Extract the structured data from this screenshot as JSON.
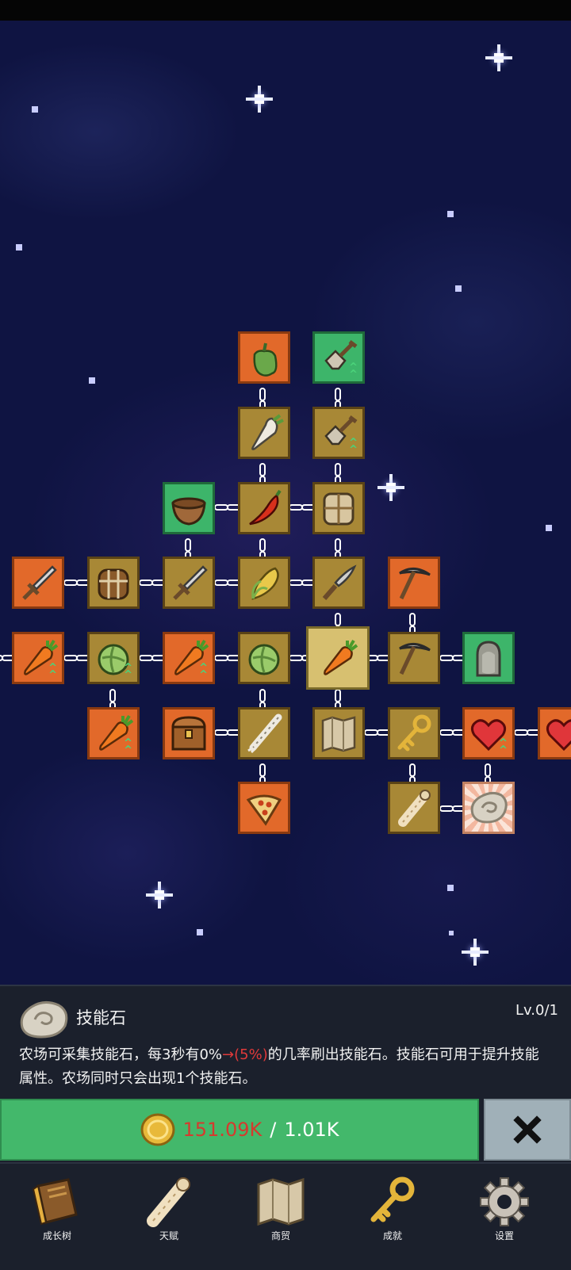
{
  "skill": {
    "title": "技能石",
    "level": "Lv.0/1",
    "desc_before": "农场可采集技能石，每3秒有0%",
    "desc_arrow": "→",
    "desc_highlight": "(5%)",
    "desc_after": "的几率刷出技能石。技能石可用于提升技能属性。农场同时只会出现1个技能石。"
  },
  "cost": {
    "have": "151.09K",
    "separator": "/",
    "need": "1.01K"
  },
  "nav": [
    {
      "label": "成长树",
      "icon": "book-icon"
    },
    {
      "label": "天赋",
      "icon": "scroll-icon"
    },
    {
      "label": "商贸",
      "icon": "map-icon"
    },
    {
      "label": "成就",
      "icon": "key-icon"
    },
    {
      "label": "设置",
      "icon": "gear-icon"
    }
  ],
  "nodes": [
    {
      "id": "pepper",
      "icon": "pepper-icon",
      "color": "orange"
    },
    {
      "id": "shovel-green",
      "icon": "shovel-icon",
      "color": "green",
      "upgrade": true
    },
    {
      "id": "radish",
      "icon": "radish-icon",
      "color": "tan"
    },
    {
      "id": "shovel",
      "icon": "shovel-icon",
      "color": "tan",
      "upgrade": true
    },
    {
      "id": "bowl",
      "icon": "bowl-icon",
      "color": "green"
    },
    {
      "id": "chili",
      "icon": "chili-icon",
      "color": "tan"
    },
    {
      "id": "sack",
      "icon": "sack-icon",
      "color": "tan"
    },
    {
      "id": "sword-orange",
      "icon": "sword-icon",
      "color": "orange"
    },
    {
      "id": "backpack",
      "icon": "backpack-icon",
      "color": "tan"
    },
    {
      "id": "sword",
      "icon": "sword-icon",
      "color": "tan"
    },
    {
      "id": "corn",
      "icon": "corn-icon",
      "color": "tan"
    },
    {
      "id": "knife",
      "icon": "knife-icon",
      "color": "tan"
    },
    {
      "id": "pickaxe-orange",
      "icon": "pickaxe-icon",
      "color": "orange"
    },
    {
      "id": "carrot-boost-1",
      "icon": "carrot-icon",
      "color": "orange",
      "upgrade": true
    },
    {
      "id": "cabbage-1",
      "icon": "cabbage-icon",
      "color": "tan",
      "upgrade": true
    },
    {
      "id": "carrot-boost-2",
      "icon": "carrot-icon",
      "color": "orange",
      "upgrade": true
    },
    {
      "id": "cabbage-2",
      "icon": "cabbage-icon",
      "color": "tan"
    },
    {
      "id": "carrot-selected",
      "icon": "carrot-icon",
      "color": "selected"
    },
    {
      "id": "pickaxe",
      "icon": "pickaxe-icon",
      "color": "tan"
    },
    {
      "id": "statue",
      "icon": "statue-icon",
      "color": "green"
    },
    {
      "id": "carrot-boost-3",
      "icon": "carrot-icon",
      "color": "orange",
      "upgrade": true
    },
    {
      "id": "chest",
      "icon": "chest-icon",
      "color": "orange"
    },
    {
      "id": "leek",
      "icon": "leek-icon",
      "color": "tan"
    },
    {
      "id": "map",
      "icon": "map-icon",
      "color": "tan"
    },
    {
      "id": "key",
      "icon": "key-icon",
      "color": "tan"
    },
    {
      "id": "heart",
      "icon": "heart-icon",
      "color": "orange",
      "upgrade": true
    },
    {
      "id": "heart-edge",
      "icon": "heart-icon",
      "color": "orange"
    },
    {
      "id": "pizza",
      "icon": "pizza-icon",
      "color": "orange"
    },
    {
      "id": "scroll",
      "icon": "scroll-icon",
      "color": "tan"
    },
    {
      "id": "skill-stone",
      "icon": "stone-icon",
      "color": "burst"
    }
  ]
}
